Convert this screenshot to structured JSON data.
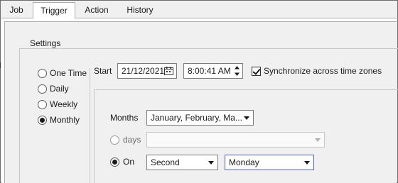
{
  "tabs": [
    {
      "label": "Job",
      "active": false
    },
    {
      "label": "Trigger",
      "active": true
    },
    {
      "label": "Action",
      "active": false
    },
    {
      "label": "History",
      "active": false
    }
  ],
  "settings": {
    "title": "Settings",
    "frequency_options": [
      {
        "label": "One Time",
        "checked": false
      },
      {
        "label": "Daily",
        "checked": false
      },
      {
        "label": "Weekly",
        "checked": false
      },
      {
        "label": "Monthly",
        "checked": true
      }
    ],
    "start_label": "Start",
    "start_date": "21/12/2021",
    "start_time": "8:00:41 AM",
    "sync_timezones": {
      "label": "Synchronize across time zones",
      "checked": true
    }
  },
  "monthly": {
    "months_label": "Months",
    "months_value": "January, February, Ma...",
    "days": {
      "label": "days",
      "checked": false,
      "value": ""
    },
    "on": {
      "label": "On",
      "checked": true,
      "week_value": "Second",
      "day_value": "Monday"
    }
  },
  "colors": {
    "accent": "#4a5ee8",
    "panel": "#f0f0f0"
  }
}
